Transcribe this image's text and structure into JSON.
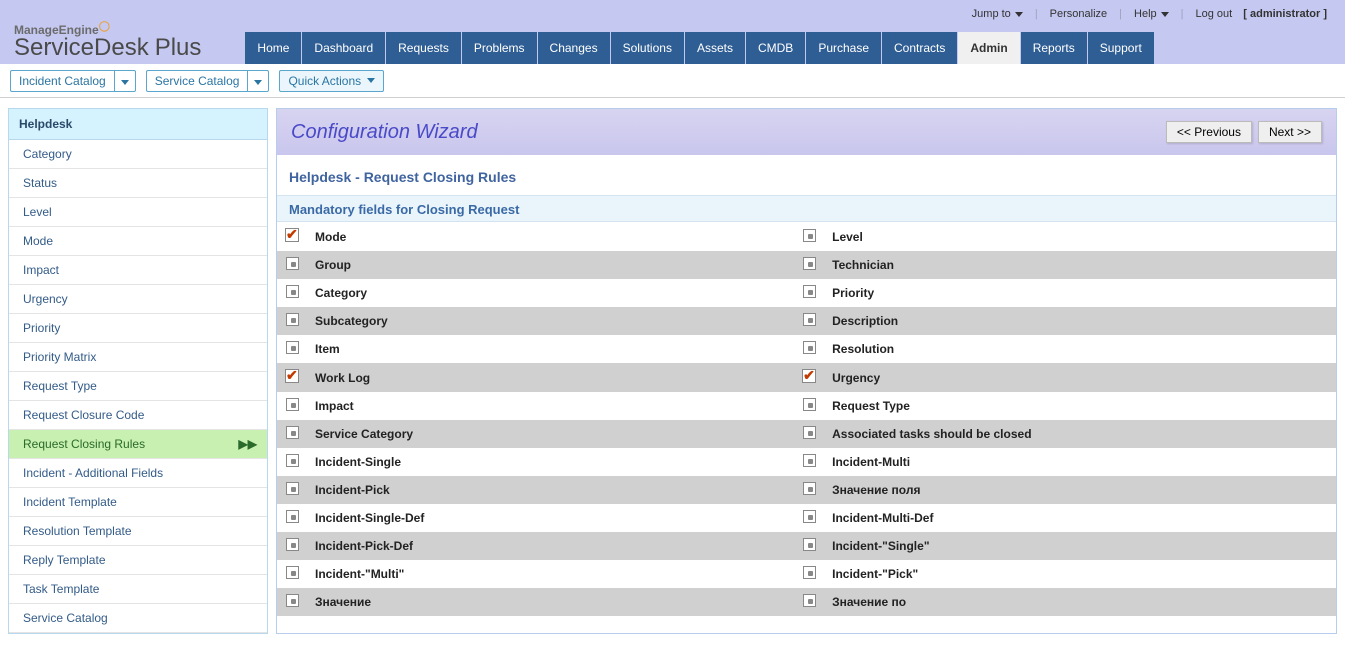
{
  "top": {
    "jump": "Jump to",
    "personalize": "Personalize",
    "help": "Help",
    "logout": "Log out",
    "user": "[ administrator ]"
  },
  "logo": {
    "vendor": "ManageEngine",
    "product": "ServiceDesk",
    "suffix": "Plus"
  },
  "nav": {
    "home": "Home",
    "dashboard": "Dashboard",
    "requests": "Requests",
    "problems": "Problems",
    "changes": "Changes",
    "solutions": "Solutions",
    "assets": "Assets",
    "cmdb": "CMDB",
    "purchase": "Purchase",
    "contracts": "Contracts",
    "admin": "Admin",
    "reports": "Reports",
    "support": "Support"
  },
  "subnav": {
    "incident": "Incident Catalog",
    "service": "Service Catalog",
    "quick": "Quick Actions"
  },
  "sidebar": {
    "header": "Helpdesk",
    "items": [
      "Category",
      "Status",
      "Level",
      "Mode",
      "Impact",
      "Urgency",
      "Priority",
      "Priority Matrix",
      "Request Type",
      "Request Closure Code",
      "Request Closing Rules",
      "Incident - Additional Fields",
      "Incident Template",
      "Resolution Template",
      "Reply Template",
      "Task Template",
      "Service Catalog"
    ],
    "activeIndex": 10
  },
  "wizard": {
    "title": "Configuration Wizard",
    "prev": "<< Previous",
    "next": "Next >>"
  },
  "page": {
    "title": "Helpdesk - Request Closing Rules",
    "subsection": "Mandatory fields for Closing Request"
  },
  "fields": [
    {
      "left": "Mode",
      "lchecked": true,
      "right": "Level",
      "rchecked": false
    },
    {
      "left": "Group",
      "lchecked": false,
      "right": "Technician",
      "rchecked": false
    },
    {
      "left": "Category",
      "lchecked": false,
      "right": "Priority",
      "rchecked": false
    },
    {
      "left": "Subcategory",
      "lchecked": false,
      "right": "Description",
      "rchecked": false
    },
    {
      "left": "Item",
      "lchecked": false,
      "right": "Resolution",
      "rchecked": false
    },
    {
      "left": "Work Log",
      "lchecked": true,
      "right": "Urgency",
      "rchecked": true
    },
    {
      "left": "Impact",
      "lchecked": false,
      "right": "Request Type",
      "rchecked": false
    },
    {
      "left": "Service Category",
      "lchecked": false,
      "right": "Associated tasks should be closed",
      "rchecked": false
    },
    {
      "left": "Incident-Single",
      "lchecked": false,
      "right": "Incident-Multi",
      "rchecked": false
    },
    {
      "left": "Incident-Pick",
      "lchecked": false,
      "right": "Значение поля",
      "rchecked": false
    },
    {
      "left": "Incident-Single-Def",
      "lchecked": false,
      "right": "Incident-Multi-Def",
      "rchecked": false
    },
    {
      "left": "Incident-Pick-Def",
      "lchecked": false,
      "right": "Incident-\"Single\"",
      "rchecked": false
    },
    {
      "left": "Incident-\"Multi\"",
      "lchecked": false,
      "right": "Incident-\"Pick\"",
      "rchecked": false
    },
    {
      "left": "Значение",
      "lchecked": false,
      "right": "Значение по",
      "rchecked": false
    }
  ]
}
